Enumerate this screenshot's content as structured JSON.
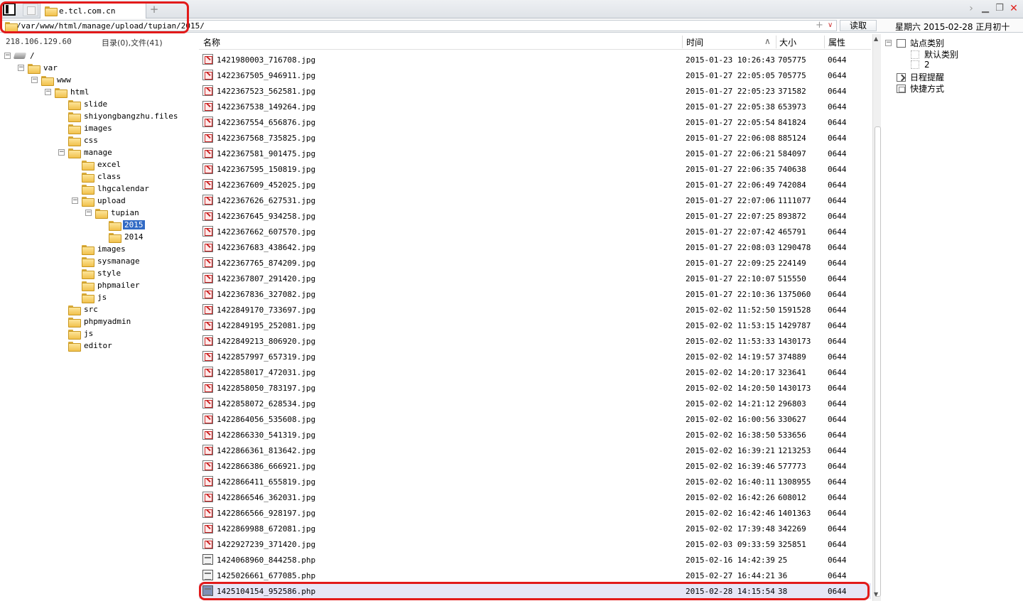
{
  "tabs": {
    "active_label": "e.tcl.com.cn",
    "add_label": "+"
  },
  "window": {
    "chevron": "›",
    "min": "▁",
    "max": "❐",
    "close": "✕"
  },
  "address": {
    "path": "/var/www/html/manage/upload/tupian/2015/",
    "plus": "+",
    "drop": "∨",
    "read_label": "读取"
  },
  "date_text": "星期六 2015-02-28 正月初十",
  "status": {
    "ip": "218.106.129.60",
    "dircount": "目录(0),文件(41)"
  },
  "tree": {
    "root": "/",
    "nodes": [
      "var",
      "www",
      "html",
      "slide",
      "shiyongbangzhu.files",
      "images",
      "css",
      "manage",
      "excel",
      "class",
      "lhgcalendar",
      "upload",
      "tupian",
      "2015",
      "2014",
      "images",
      "sysmanage",
      "style",
      "phpmailer",
      "js",
      "src",
      "phpmyadmin",
      "js",
      "editor"
    ],
    "selected": "2015"
  },
  "list": {
    "headers": {
      "name": "名称",
      "time": "时间",
      "sort": "∧",
      "size": "大小",
      "attr": "属性"
    },
    "rows": [
      {
        "name": "1421980003_716708.jpg",
        "time": "2015-01-23 10:26:43",
        "size": "705775",
        "attr": "0644",
        "type": "jpg"
      },
      {
        "name": "1422367505_946911.jpg",
        "time": "2015-01-27 22:05:05",
        "size": "705775",
        "attr": "0644",
        "type": "jpg"
      },
      {
        "name": "1422367523_562581.jpg",
        "time": "2015-01-27 22:05:23",
        "size": "371582",
        "attr": "0644",
        "type": "jpg"
      },
      {
        "name": "1422367538_149264.jpg",
        "time": "2015-01-27 22:05:38",
        "size": "653973",
        "attr": "0644",
        "type": "jpg"
      },
      {
        "name": "1422367554_656876.jpg",
        "time": "2015-01-27 22:05:54",
        "size": "841824",
        "attr": "0644",
        "type": "jpg"
      },
      {
        "name": "1422367568_735825.jpg",
        "time": "2015-01-27 22:06:08",
        "size": "885124",
        "attr": "0644",
        "type": "jpg"
      },
      {
        "name": "1422367581_901475.jpg",
        "time": "2015-01-27 22:06:21",
        "size": "584097",
        "attr": "0644",
        "type": "jpg"
      },
      {
        "name": "1422367595_150819.jpg",
        "time": "2015-01-27 22:06:35",
        "size": "740638",
        "attr": "0644",
        "type": "jpg"
      },
      {
        "name": "1422367609_452025.jpg",
        "time": "2015-01-27 22:06:49",
        "size": "742084",
        "attr": "0644",
        "type": "jpg"
      },
      {
        "name": "1422367626_627531.jpg",
        "time": "2015-01-27 22:07:06",
        "size": "1111077",
        "attr": "0644",
        "type": "jpg"
      },
      {
        "name": "1422367645_934258.jpg",
        "time": "2015-01-27 22:07:25",
        "size": "893872",
        "attr": "0644",
        "type": "jpg"
      },
      {
        "name": "1422367662_607570.jpg",
        "time": "2015-01-27 22:07:42",
        "size": "465791",
        "attr": "0644",
        "type": "jpg"
      },
      {
        "name": "1422367683_438642.jpg",
        "time": "2015-01-27 22:08:03",
        "size": "1290478",
        "attr": "0644",
        "type": "jpg"
      },
      {
        "name": "1422367765_874209.jpg",
        "time": "2015-01-27 22:09:25",
        "size": "224149",
        "attr": "0644",
        "type": "jpg"
      },
      {
        "name": "1422367807_291420.jpg",
        "time": "2015-01-27 22:10:07",
        "size": "515550",
        "attr": "0644",
        "type": "jpg"
      },
      {
        "name": "1422367836_327082.jpg",
        "time": "2015-01-27 22:10:36",
        "size": "1375060",
        "attr": "0644",
        "type": "jpg"
      },
      {
        "name": "1422849170_733697.jpg",
        "time": "2015-02-02 11:52:50",
        "size": "1591528",
        "attr": "0644",
        "type": "jpg"
      },
      {
        "name": "1422849195_252081.jpg",
        "time": "2015-02-02 11:53:15",
        "size": "1429787",
        "attr": "0644",
        "type": "jpg"
      },
      {
        "name": "1422849213_806920.jpg",
        "time": "2015-02-02 11:53:33",
        "size": "1430173",
        "attr": "0644",
        "type": "jpg"
      },
      {
        "name": "1422857997_657319.jpg",
        "time": "2015-02-02 14:19:57",
        "size": "374889",
        "attr": "0644",
        "type": "jpg"
      },
      {
        "name": "1422858017_472031.jpg",
        "time": "2015-02-02 14:20:17",
        "size": "323641",
        "attr": "0644",
        "type": "jpg"
      },
      {
        "name": "1422858050_783197.jpg",
        "time": "2015-02-02 14:20:50",
        "size": "1430173",
        "attr": "0644",
        "type": "jpg"
      },
      {
        "name": "1422858072_628534.jpg",
        "time": "2015-02-02 14:21:12",
        "size": "296803",
        "attr": "0644",
        "type": "jpg"
      },
      {
        "name": "1422864056_535608.jpg",
        "time": "2015-02-02 16:00:56",
        "size": "330627",
        "attr": "0644",
        "type": "jpg"
      },
      {
        "name": "1422866330_541319.jpg",
        "time": "2015-02-02 16:38:50",
        "size": "533656",
        "attr": "0644",
        "type": "jpg"
      },
      {
        "name": "1422866361_813642.jpg",
        "time": "2015-02-02 16:39:21",
        "size": "1213253",
        "attr": "0644",
        "type": "jpg"
      },
      {
        "name": "1422866386_666921.jpg",
        "time": "2015-02-02 16:39:46",
        "size": "577773",
        "attr": "0644",
        "type": "jpg"
      },
      {
        "name": "1422866411_655819.jpg",
        "time": "2015-02-02 16:40:11",
        "size": "1308955",
        "attr": "0644",
        "type": "jpg"
      },
      {
        "name": "1422866546_362031.jpg",
        "time": "2015-02-02 16:42:26",
        "size": "608012",
        "attr": "0644",
        "type": "jpg"
      },
      {
        "name": "1422866566_928197.jpg",
        "time": "2015-02-02 16:42:46",
        "size": "1401363",
        "attr": "0644",
        "type": "jpg"
      },
      {
        "name": "1422869988_672081.jpg",
        "time": "2015-02-02 17:39:48",
        "size": "342269",
        "attr": "0644",
        "type": "jpg"
      },
      {
        "name": "1422927239_371420.jpg",
        "time": "2015-02-03 09:33:59",
        "size": "325851",
        "attr": "0644",
        "type": "jpg"
      },
      {
        "name": "1424068960_844258.php",
        "time": "2015-02-16 14:42:39",
        "size": "25",
        "attr": "0644",
        "type": "php"
      },
      {
        "name": "1425026661_677085.php",
        "time": "2015-02-27 16:44:21",
        "size": "36",
        "attr": "0644",
        "type": "php"
      },
      {
        "name": "1425104154_952586.php",
        "time": "2015-02-28 14:15:54",
        "size": "38",
        "attr": "0644",
        "type": "php",
        "selected": true
      }
    ]
  },
  "scroll": {
    "up": "▲",
    "down": "▼"
  },
  "right_panel": {
    "site_category": "站点类别",
    "site_children": [
      "默认类别",
      "2"
    ],
    "schedule": "日程提醒",
    "shortcut": "快捷方式"
  },
  "colors": {
    "highlight": "#e21a1a",
    "selection": "#316ac5",
    "selected_row": "#e6e6f6"
  }
}
